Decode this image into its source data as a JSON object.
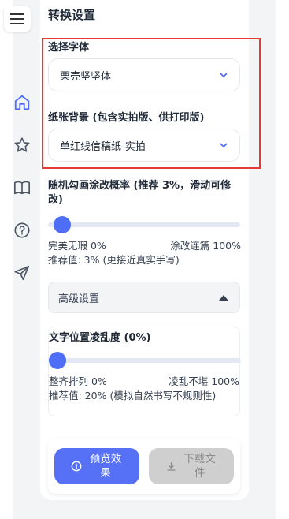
{
  "panel": {
    "title": "转换设置"
  },
  "font_select": {
    "label": "选择字体",
    "value": "栗壳坚坚体"
  },
  "paper_select": {
    "label": "纸张背景 (包含实拍版、供打印版)",
    "value": "单红线信稿纸-实拍"
  },
  "doodle": {
    "label": "随机勾画涂改概率 (推荐 3%，滑动可修改)",
    "value_fraction": 0.03,
    "min_label": "完美无瑕 0%",
    "max_label": "涂改连篇 100%",
    "hint": "推荐值: 3% (更接近真实手写)"
  },
  "advanced": {
    "label": "高级设置",
    "jitter_label": "文字位置凌乱度 (0%)",
    "jitter_value_fraction": 0.0,
    "min_label": "整齐排列 0%",
    "max_label": "凌乱不堪 100%",
    "hint": "推荐值: 20% (模拟自然书写不规则性)"
  },
  "actions": {
    "preview_label": "预览效果",
    "download_label": "下载文件"
  },
  "colors": {
    "accent": "#4f6ef7",
    "highlight_border": "#e53935",
    "disabled": "#cfcfcf"
  },
  "icons": {
    "menu": "hamburger-icon",
    "rail": [
      "home-icon",
      "star-icon",
      "book-icon",
      "help-icon",
      "send-icon"
    ],
    "chevron": "chevron-down-icon",
    "preview": "info-icon",
    "download": "download-icon"
  }
}
